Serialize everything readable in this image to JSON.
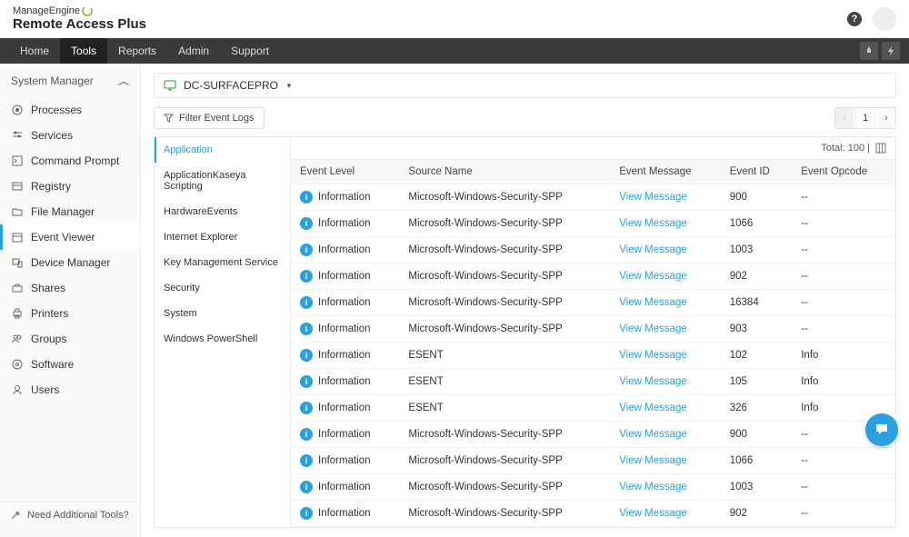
{
  "brand": {
    "top": "ManageEngine",
    "bottom": "Remote Access Plus"
  },
  "nav": {
    "items": [
      "Home",
      "Tools",
      "Reports",
      "Admin",
      "Support"
    ],
    "active_index": 1
  },
  "sidebar": {
    "header": "System Manager",
    "items": [
      {
        "label": "Processes",
        "icon": "target-icon"
      },
      {
        "label": "Services",
        "icon": "sliders-icon"
      },
      {
        "label": "Command Prompt",
        "icon": "terminal-icon"
      },
      {
        "label": "Registry",
        "icon": "registry-icon"
      },
      {
        "label": "File Manager",
        "icon": "folder-icon"
      },
      {
        "label": "Event Viewer",
        "icon": "calendar-icon"
      },
      {
        "label": "Device Manager",
        "icon": "devices-icon"
      },
      {
        "label": "Shares",
        "icon": "share-icon"
      },
      {
        "label": "Printers",
        "icon": "printer-icon"
      },
      {
        "label": "Groups",
        "icon": "group-icon"
      },
      {
        "label": "Software",
        "icon": "disc-icon"
      },
      {
        "label": "Users",
        "icon": "users-icon"
      }
    ],
    "selected_index": 5,
    "footer": "Need Additional Tools?"
  },
  "device": {
    "name": "DC-SURFACEPRO"
  },
  "filter_btn": "Filter Event Logs",
  "pager": {
    "page": "1"
  },
  "categories": {
    "items": [
      "Application",
      "ApplicationKaseya Scripting",
      "HardwareEvents",
      "Internet Explorer",
      "Key Management Service",
      "Security",
      "System",
      "Windows PowerShell"
    ],
    "active_index": 0
  },
  "table": {
    "total_label": "Total: 100  |",
    "columns": [
      "Event Level",
      "Source Name",
      "Event Message",
      "Event ID",
      "Event Opcode"
    ],
    "view_message_label": "View Message",
    "rows": [
      {
        "level": "Information",
        "source": "Microsoft-Windows-Security-SPP",
        "event_id": "900",
        "opcode": "--"
      },
      {
        "level": "Information",
        "source": "Microsoft-Windows-Security-SPP",
        "event_id": "1066",
        "opcode": "--"
      },
      {
        "level": "Information",
        "source": "Microsoft-Windows-Security-SPP",
        "event_id": "1003",
        "opcode": "--"
      },
      {
        "level": "Information",
        "source": "Microsoft-Windows-Security-SPP",
        "event_id": "902",
        "opcode": "--"
      },
      {
        "level": "Information",
        "source": "Microsoft-Windows-Security-SPP",
        "event_id": "16384",
        "opcode": "--"
      },
      {
        "level": "Information",
        "source": "Microsoft-Windows-Security-SPP",
        "event_id": "903",
        "opcode": "--"
      },
      {
        "level": "Information",
        "source": "ESENT",
        "event_id": "102",
        "opcode": "Info"
      },
      {
        "level": "Information",
        "source": "ESENT",
        "event_id": "105",
        "opcode": "Info"
      },
      {
        "level": "Information",
        "source": "ESENT",
        "event_id": "326",
        "opcode": "Info"
      },
      {
        "level": "Information",
        "source": "Microsoft-Windows-Security-SPP",
        "event_id": "900",
        "opcode": "--"
      },
      {
        "level": "Information",
        "source": "Microsoft-Windows-Security-SPP",
        "event_id": "1066",
        "opcode": "--"
      },
      {
        "level": "Information",
        "source": "Microsoft-Windows-Security-SPP",
        "event_id": "1003",
        "opcode": "--"
      },
      {
        "level": "Information",
        "source": "Microsoft-Windows-Security-SPP",
        "event_id": "902",
        "opcode": "--"
      }
    ]
  }
}
